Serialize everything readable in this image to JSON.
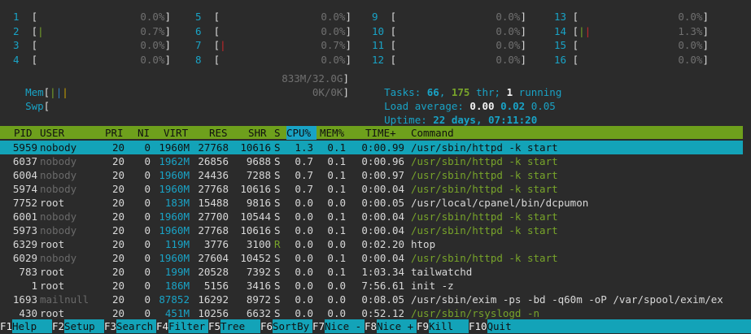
{
  "cpu_meters": [
    {
      "id": "1",
      "pct": "0.0%"
    },
    {
      "id": "2",
      "pct": "0.7%"
    },
    {
      "id": "3",
      "pct": "0.0%"
    },
    {
      "id": "4",
      "pct": "0.0%"
    },
    {
      "id": "5",
      "pct": "0.0%"
    },
    {
      "id": "6",
      "pct": "0.0%"
    },
    {
      "id": "7",
      "pct": "0.7%"
    },
    {
      "id": "8",
      "pct": "0.0%"
    },
    {
      "id": "9",
      "pct": "0.0%"
    },
    {
      "id": "10",
      "pct": "0.0%"
    },
    {
      "id": "11",
      "pct": "0.0%"
    },
    {
      "id": "12",
      "pct": "0.0%"
    },
    {
      "id": "13",
      "pct": "0.0%"
    },
    {
      "id": "14",
      "pct": "1.3%"
    },
    {
      "id": "15",
      "pct": "0.0%"
    },
    {
      "id": "16",
      "pct": "0.0%"
    }
  ],
  "mem": {
    "label": "Mem",
    "value": "833M/32.0G"
  },
  "swp": {
    "label": "Swp",
    "value": "0K/0K"
  },
  "tasks": {
    "label": "Tasks: ",
    "count": "66",
    "sep": ", ",
    "threads": "175",
    "thr_label": " thr; ",
    "running": "1",
    "running_label": " running"
  },
  "load": {
    "label": "Load average: ",
    "l1": "0.00",
    "l5": "0.02",
    "l15": "0.05"
  },
  "uptime": {
    "label": "Uptime: ",
    "value": "22 days, 07:11:20"
  },
  "columns": {
    "pid": "PID",
    "user": "USER",
    "pri": "PRI",
    "ni": "NI",
    "virt": "VIRT",
    "res": "RES",
    "shr": "SHR",
    "s": "S",
    "cpu": "CPU%",
    "mem": "MEM%",
    "time": "TIME+",
    "cmd": "Command"
  },
  "processes": [
    {
      "pid": "5959",
      "user": "nobody",
      "pri": "20",
      "ni": "0",
      "virt": "1960M",
      "res": "27768",
      "shr": "10616",
      "s": "S",
      "cpu": "1.3",
      "mem": "0.1",
      "time": "0:00.99",
      "cmd": "/usr/sbin/httpd -k start"
    },
    {
      "pid": "6037",
      "user": "nobody",
      "pri": "20",
      "ni": "0",
      "virt": "1962M",
      "res": "26856",
      "shr": "9688",
      "s": "S",
      "cpu": "0.7",
      "mem": "0.1",
      "time": "0:00.96",
      "cmd": "/usr/sbin/httpd -k start"
    },
    {
      "pid": "6004",
      "user": "nobody",
      "pri": "20",
      "ni": "0",
      "virt": "1960M",
      "res": "24436",
      "shr": "7288",
      "s": "S",
      "cpu": "0.7",
      "mem": "0.1",
      "time": "0:00.97",
      "cmd": "/usr/sbin/httpd -k start"
    },
    {
      "pid": "5974",
      "user": "nobody",
      "pri": "20",
      "ni": "0",
      "virt": "1960M",
      "res": "27768",
      "shr": "10616",
      "s": "S",
      "cpu": "0.7",
      "mem": "0.1",
      "time": "0:00.04",
      "cmd": "/usr/sbin/httpd -k start"
    },
    {
      "pid": "7752",
      "user": "root",
      "pri": "20",
      "ni": "0",
      "virt": "183M",
      "res": "15488",
      "shr": "9816",
      "s": "S",
      "cpu": "0.0",
      "mem": "0.0",
      "time": "0:00.05",
      "cmd": "/usr/local/cpanel/bin/dcpumon"
    },
    {
      "pid": "6001",
      "user": "nobody",
      "pri": "20",
      "ni": "0",
      "virt": "1960M",
      "res": "27700",
      "shr": "10544",
      "s": "S",
      "cpu": "0.0",
      "mem": "0.1",
      "time": "0:00.04",
      "cmd": "/usr/sbin/httpd -k start"
    },
    {
      "pid": "5973",
      "user": "nobody",
      "pri": "20",
      "ni": "0",
      "virt": "1960M",
      "res": "27768",
      "shr": "10616",
      "s": "S",
      "cpu": "0.0",
      "mem": "0.1",
      "time": "0:00.04",
      "cmd": "/usr/sbin/httpd -k start"
    },
    {
      "pid": "6329",
      "user": "root",
      "pri": "20",
      "ni": "0",
      "virt": "119M",
      "res": "3776",
      "shr": "3100",
      "s": "R",
      "cpu": "0.0",
      "mem": "0.0",
      "time": "0:02.20",
      "cmd": "htop"
    },
    {
      "pid": "6029",
      "user": "nobody",
      "pri": "20",
      "ni": "0",
      "virt": "1960M",
      "res": "27604",
      "shr": "10452",
      "s": "S",
      "cpu": "0.0",
      "mem": "0.1",
      "time": "0:00.04",
      "cmd": "/usr/sbin/httpd -k start"
    },
    {
      "pid": "783",
      "user": "root",
      "pri": "20",
      "ni": "0",
      "virt": "199M",
      "res": "20528",
      "shr": "7392",
      "s": "S",
      "cpu": "0.0",
      "mem": "0.1",
      "time": "1:03.34",
      "cmd": "tailwatchd"
    },
    {
      "pid": "1",
      "user": "root",
      "pri": "20",
      "ni": "0",
      "virt": "186M",
      "res": "5156",
      "shr": "3416",
      "s": "S",
      "cpu": "0.0",
      "mem": "0.0",
      "time": "7:56.61",
      "cmd": "init -z"
    },
    {
      "pid": "1693",
      "user": "mailnull",
      "pri": "20",
      "ni": "0",
      "virt": "87852",
      "res": "16292",
      "shr": "8972",
      "s": "S",
      "cpu": "0.0",
      "mem": "0.0",
      "time": "0:08.05",
      "cmd": "/usr/sbin/exim -ps -bd -q60m -oP /var/spool/exim/ex"
    },
    {
      "pid": "430",
      "user": "root",
      "pri": "20",
      "ni": "0",
      "virt": "451M",
      "res": "10256",
      "shr": "6632",
      "s": "S",
      "cpu": "0.0",
      "mem": "0.0",
      "time": "0:52.12",
      "cmd": "/usr/sbin/rsyslogd -n"
    }
  ],
  "function_keys": [
    {
      "key": "F1",
      "label": "Help"
    },
    {
      "key": "F2",
      "label": "Setup"
    },
    {
      "key": "F3",
      "label": "Search"
    },
    {
      "key": "F4",
      "label": "Filter"
    },
    {
      "key": "F5",
      "label": "Tree"
    },
    {
      "key": "F6",
      "label": "SortBy"
    },
    {
      "key": "F7",
      "label": "Nice -"
    },
    {
      "key": "F8",
      "label": "Nice +"
    },
    {
      "key": "F9",
      "label": "Kill"
    },
    {
      "key": "F10",
      "label": "Quit"
    }
  ],
  "colors": {
    "background": "#2b2b2b",
    "cyan": "#19a3c6",
    "green": "#6ea01c",
    "selection": "#13a3b8",
    "red": "#c8272b"
  }
}
